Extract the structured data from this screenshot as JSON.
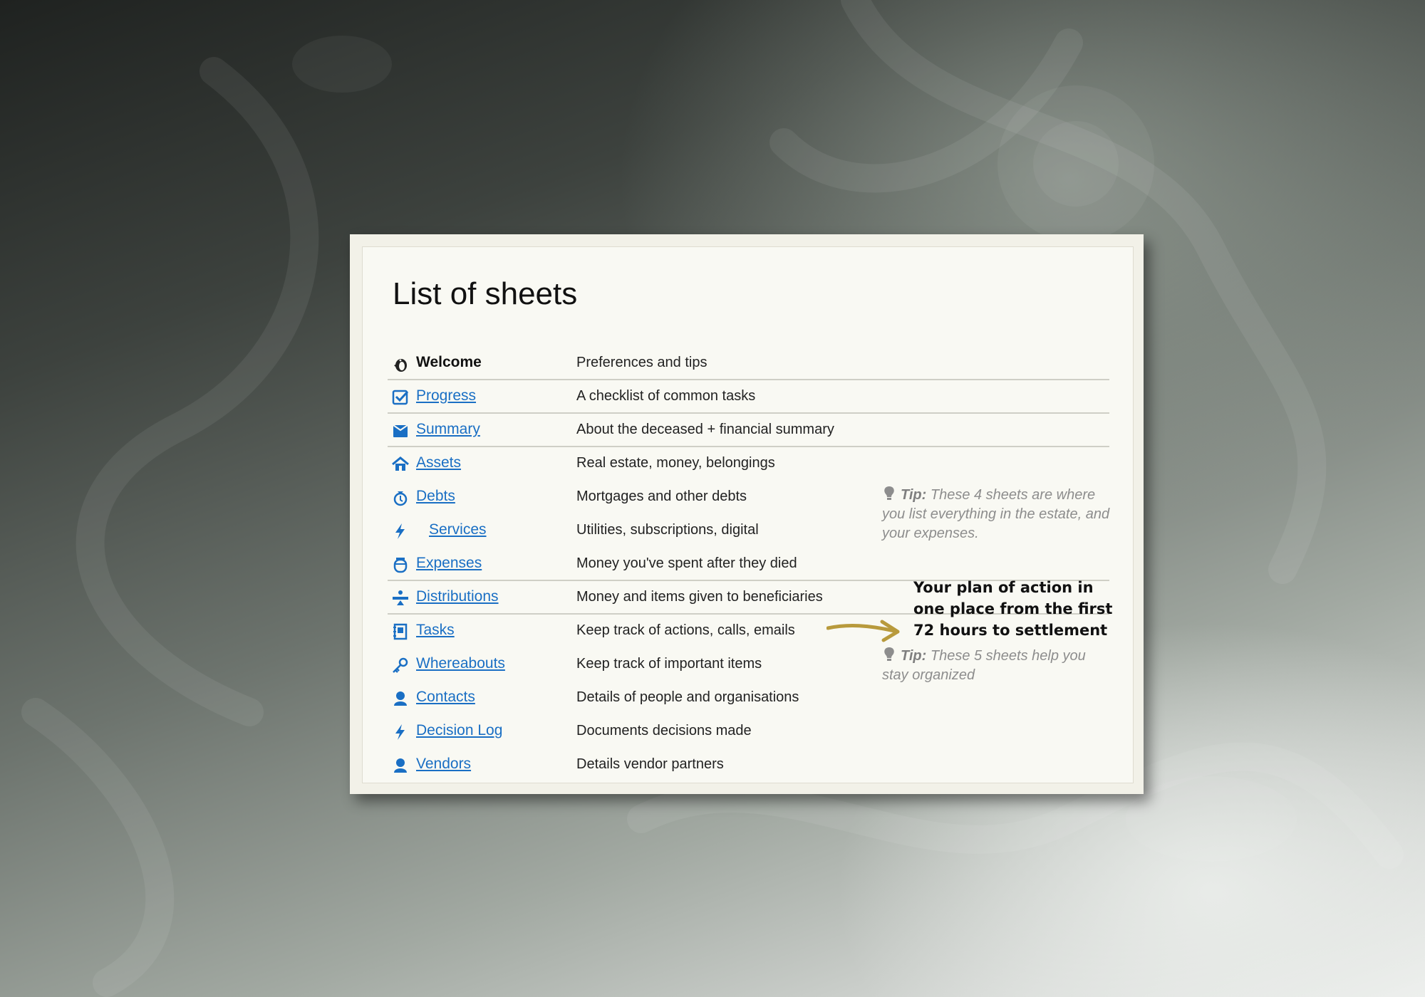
{
  "title": "List of sheets",
  "sheets": [
    {
      "name": "Welcome",
      "desc": "Preferences and tips",
      "icon": "penguin-icon",
      "current": true
    },
    {
      "name": "Progress",
      "desc": "A checklist of common tasks",
      "icon": "checkbox-icon"
    },
    {
      "name": "Summary",
      "desc": "About the deceased + financial summary",
      "icon": "folder-icon"
    },
    {
      "name": "Assets",
      "desc": "Real estate, money, belongings",
      "icon": "house-icon"
    },
    {
      "name": "Debts",
      "desc": "Mortgages and other debts",
      "icon": "money-bag-icon"
    },
    {
      "name": "Services",
      "desc": "Utilities, subscriptions, digital",
      "icon": "lightning-icon"
    },
    {
      "name": "Expenses",
      "desc": "Money you've spent after they died",
      "icon": "jar-icon"
    },
    {
      "name": "Distributions",
      "desc": "Money and items given to beneficiaries",
      "icon": "divide-icon"
    },
    {
      "name": "Tasks",
      "desc": "Keep track of actions, calls, emails",
      "icon": "notebook-icon"
    },
    {
      "name": "Whereabouts",
      "desc": "Keep track of important items",
      "icon": "key-icon"
    },
    {
      "name": "Contacts",
      "desc": "Details of people and organisations",
      "icon": "person-icon"
    },
    {
      "name": "Decision Log",
      "desc": "Documents decisions made",
      "icon": "lightning-icon"
    },
    {
      "name": "Vendors",
      "desc": "Details vendor partners",
      "icon": "person-icon"
    }
  ],
  "tip1": {
    "label": "Tip:",
    "text": "These 4 sheets are where you list everything in the estate, and your expenses."
  },
  "tip2": {
    "label": "Tip:",
    "text": "These 5 sheets help you stay organized"
  },
  "callout": "Your plan of action in\none place from the first\n72 hours to  settlement",
  "colors": {
    "link": "#1a6fc4",
    "arrow": "#b89a3c",
    "tip": "#8d8d8d"
  }
}
